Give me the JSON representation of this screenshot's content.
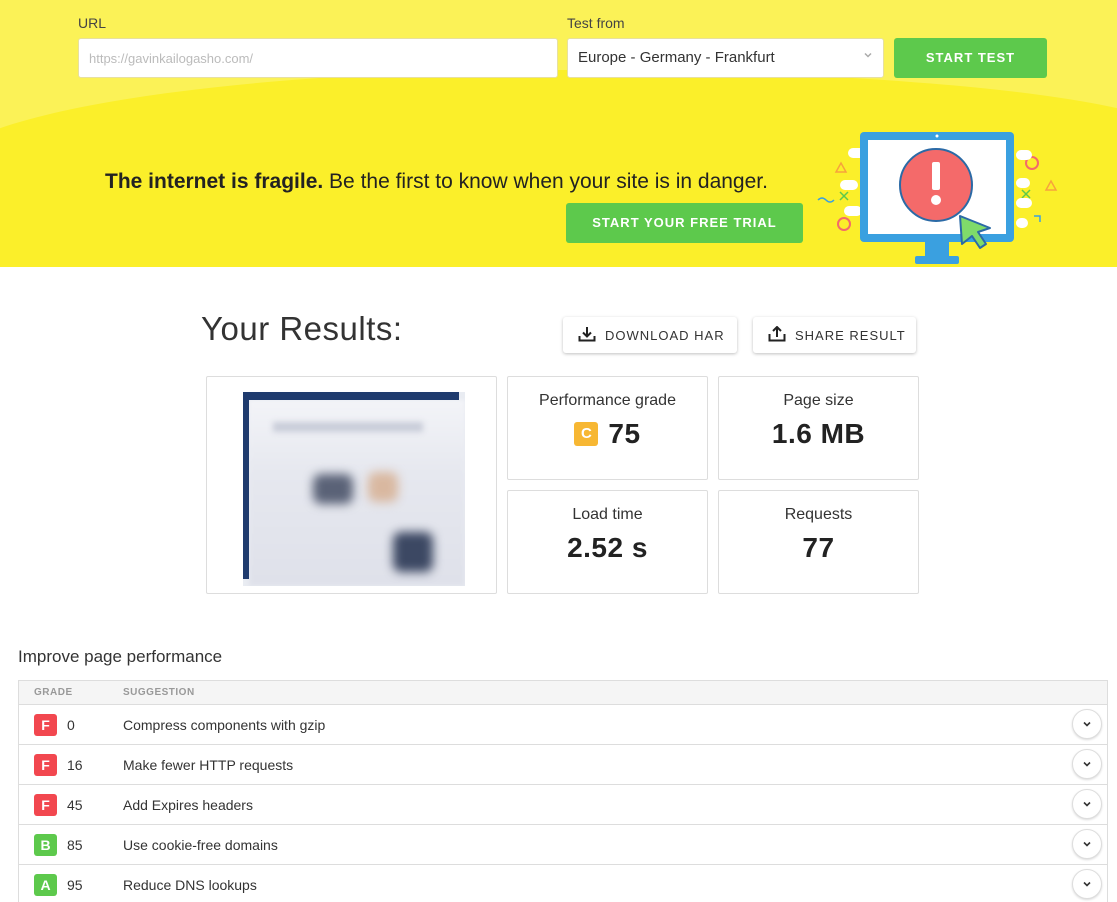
{
  "form": {
    "url_label": "URL",
    "url_value": "https://gavinkailogasho.com/",
    "location_label": "Test from",
    "location_value": "Europe - Germany - Frankfurt",
    "start_label": "START TEST"
  },
  "banner": {
    "bold_text": "The internet is fragile.",
    "text": " Be the first to know when your site is in danger.",
    "trial_label": "START YOUR FREE TRIAL",
    "illustration": "monitor-alert-illustration"
  },
  "results": {
    "title": "Your Results:",
    "download_label": "DOWNLOAD HAR",
    "share_label": "SHARE RESULT",
    "performance_label": "Performance grade",
    "performance_letter": "C",
    "performance_score": "75",
    "page_size_label": "Page size",
    "page_size_value": "1.6 MB",
    "load_time_label": "Load time",
    "load_time_value": "2.52 s",
    "requests_label": "Requests",
    "requests_value": "77"
  },
  "improve": {
    "title": "Improve page performance",
    "col_grade": "GRADE",
    "col_suggestion": "SUGGESTION",
    "rows": [
      {
        "grade": "F",
        "score": "0",
        "suggestion": "Compress components with gzip",
        "color": "#f2474f"
      },
      {
        "grade": "F",
        "score": "16",
        "suggestion": "Make fewer HTTP requests",
        "color": "#f2474f"
      },
      {
        "grade": "F",
        "score": "45",
        "suggestion": "Add Expires headers",
        "color": "#f2474f"
      },
      {
        "grade": "B",
        "score": "85",
        "suggestion": "Use cookie-free domains",
        "color": "#5dc94c"
      },
      {
        "grade": "A",
        "score": "95",
        "suggestion": "Reduce DNS lookups",
        "color": "#5dc94c"
      }
    ]
  },
  "colors": {
    "accent_green": "#5dc94c",
    "banner_yellow": "#fbef2a",
    "grade_c": "#f7b733",
    "grade_f": "#f2474f"
  }
}
